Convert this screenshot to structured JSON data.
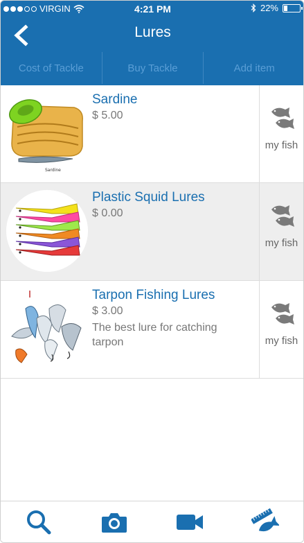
{
  "status_bar": {
    "carrier": "VIRGIN",
    "time": "4:21 PM",
    "battery": "22%",
    "battery_level": 0.22
  },
  "header": {
    "title": "Lures",
    "back_icon": "chevron-left-icon"
  },
  "segments": [
    {
      "label": "Cost of Tackle"
    },
    {
      "label": "Buy Tackle"
    },
    {
      "label": "Add item"
    }
  ],
  "items": [
    {
      "name": "Sardine",
      "price": "$ 5.00",
      "description": "",
      "action_label": "my fish",
      "thumb_caption": "Sardine"
    },
    {
      "name": "Plastic Squid Lures",
      "price": "$ 0.00",
      "description": "",
      "action_label": "my fish"
    },
    {
      "name": "Tarpon Fishing Lures",
      "price": "$ 3.00",
      "description": "The best lure  for catching tarpon",
      "action_label": "my fish"
    }
  ],
  "tabbar": [
    {
      "icon": "search-icon"
    },
    {
      "icon": "camera-icon"
    },
    {
      "icon": "video-icon"
    },
    {
      "icon": "fish-ruler-icon"
    }
  ],
  "colors": {
    "brand_blue": "#1a6fb0",
    "segment_text": "#5a9ed6",
    "icon_gray": "#777777"
  }
}
